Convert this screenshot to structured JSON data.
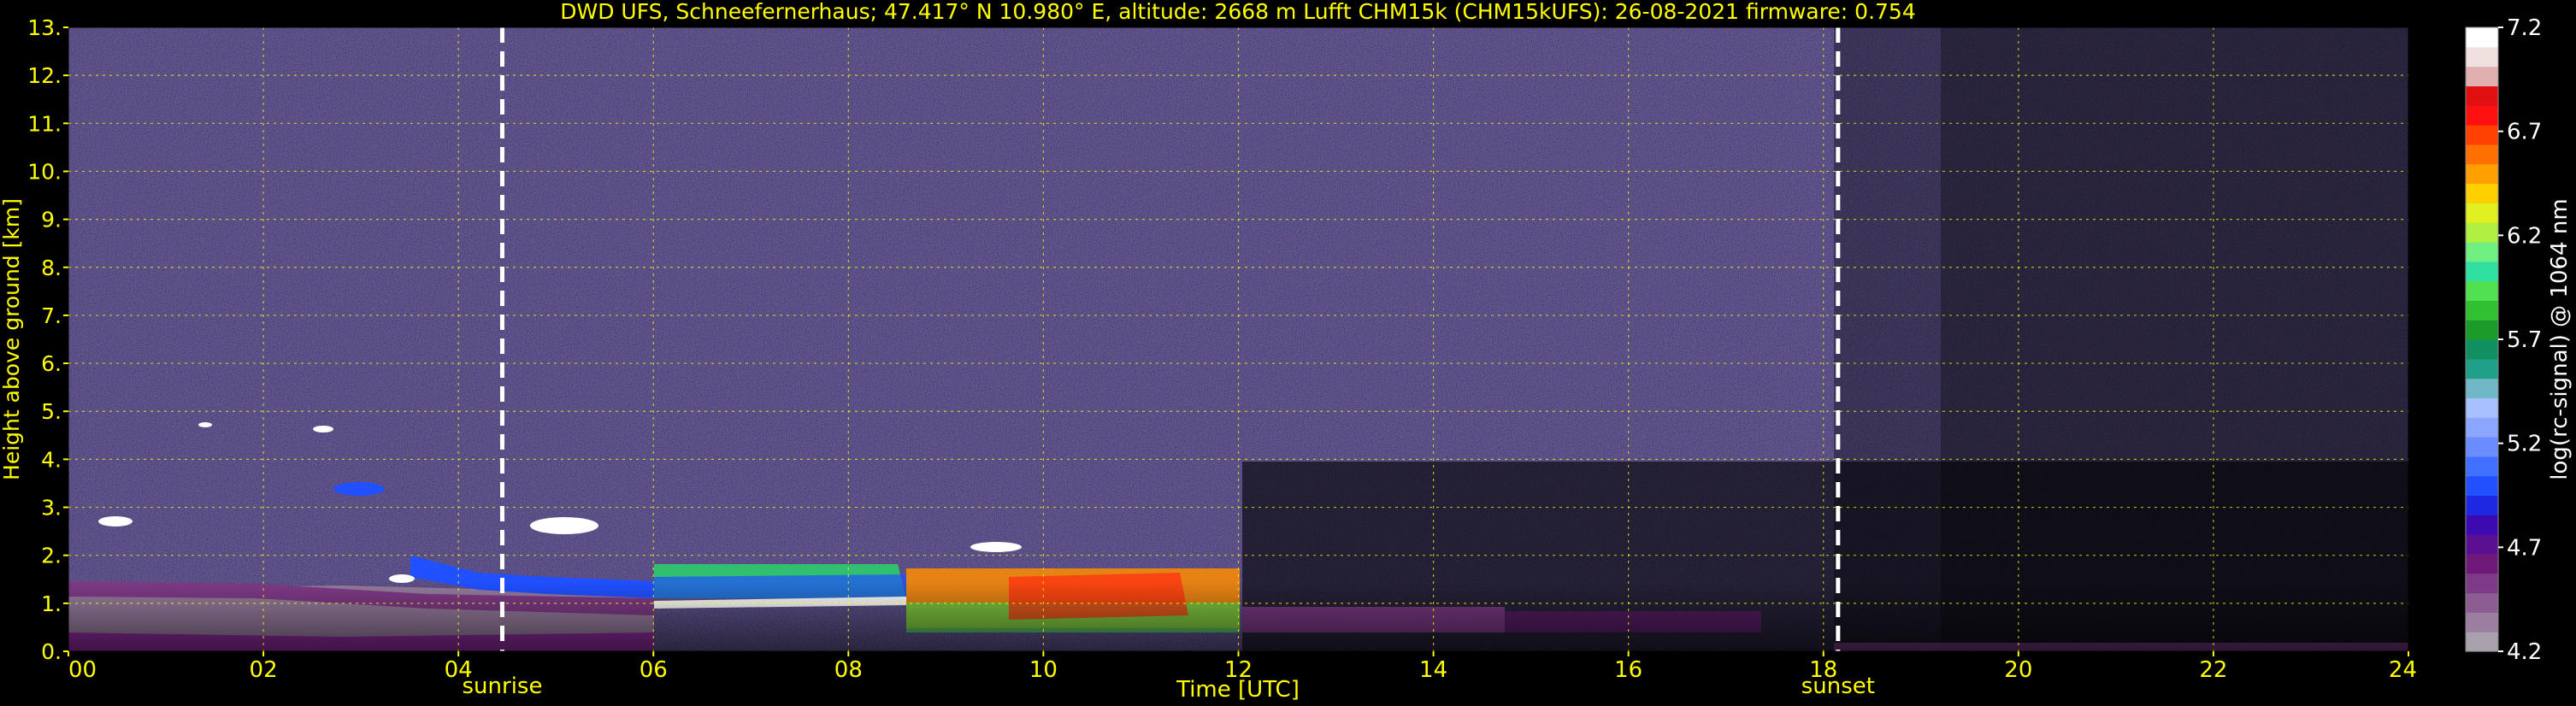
{
  "chart_data": {
    "type": "heatmap",
    "title": "DWD UFS, Schneefernerhaus; 47.417° N 10.980° E, altitude: 2668 m    Lufft CHM15k (CHM15kUFS): 26-08-2021    firmware: 0.754",
    "xlabel": "Time [UTC]",
    "ylabel": "Height above ground [km]",
    "colorbar_label": "log(rc-signal) @ 1064 nm",
    "xlim": [
      0,
      24
    ],
    "ylim": [
      0,
      13
    ],
    "x_ticks": [
      "00",
      "02",
      "04",
      "06",
      "08",
      "10",
      "12",
      "14",
      "16",
      "18",
      "20",
      "22",
      "24"
    ],
    "y_ticks": [
      "0.",
      "1.",
      "2.",
      "3.",
      "4.",
      "5.",
      "6.",
      "7.",
      "8.",
      "9.",
      "10.",
      "11.",
      "12.",
      "13."
    ],
    "colorbar_range": [
      4.2,
      7.2
    ],
    "colorbar_ticks": [
      "4.2",
      "4.7",
      "5.2",
      "5.7",
      "6.2",
      "6.7",
      "7.2"
    ],
    "colorbar_colors": [
      "#a9a2ad",
      "#9c7fa0",
      "#8d5c93",
      "#7e3a86",
      "#6f1a7a",
      "#5a1090",
      "#3c0ab0",
      "#1e28e0",
      "#2050ff",
      "#4070ff",
      "#6a8cff",
      "#8aa6ff",
      "#a8c0ff",
      "#70b8c8",
      "#20a088",
      "#109060",
      "#1c9a2a",
      "#30c030",
      "#50e050",
      "#30e0a0",
      "#70f080",
      "#b0f040",
      "#e0f020",
      "#ffd000",
      "#ffa000",
      "#ff7000",
      "#ff4000",
      "#ff1010",
      "#e01010",
      "#e0b0b0",
      "#f0e0e0",
      "#ffffff"
    ],
    "grid": true,
    "markers": [
      {
        "label": "sunrise",
        "x": 4.45
      },
      {
        "label": "sunset",
        "x": 18.15
      }
    ],
    "background_color": "#4b3a78",
    "axis_text_color": "#ffff00"
  }
}
